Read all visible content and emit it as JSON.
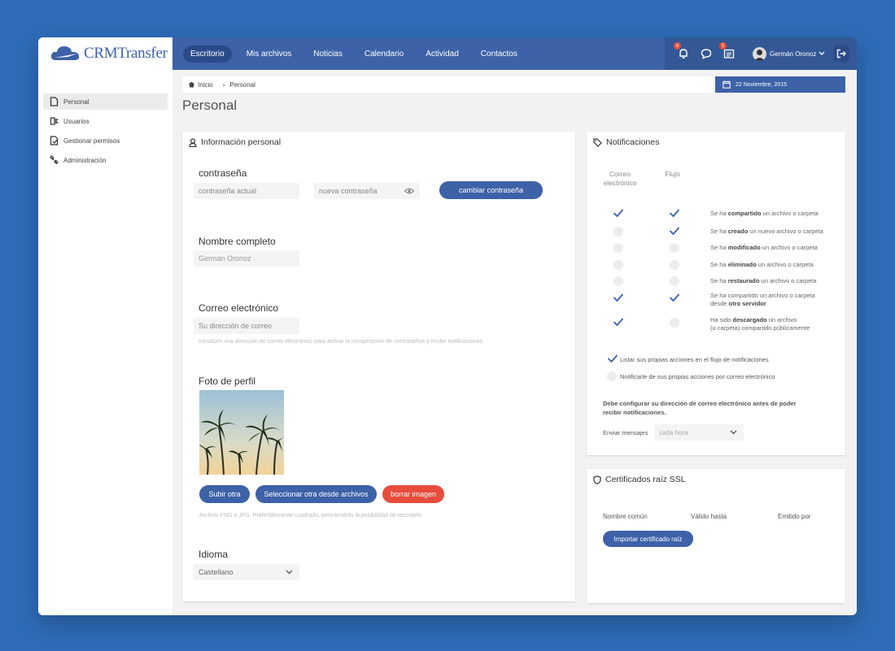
{
  "app": {
    "name": "CRMTransfer"
  },
  "nav": {
    "items": [
      "Escritorio",
      "Mis archivos",
      "Noticias",
      "Calendario",
      "Actividad",
      "Contactos"
    ]
  },
  "topbar": {
    "notifications_count": "6",
    "messages_count": "5",
    "user_name": "Germán Oronoz"
  },
  "sidebar": {
    "items": [
      "Personal",
      "Usuarios",
      "Gestionar permisos",
      "Administración"
    ]
  },
  "breadcrumb": {
    "home": "Inicio",
    "current": "Personal"
  },
  "date": "22 Noviembre, 2015",
  "page_title": "Personal",
  "personal": {
    "title": "Información personal",
    "password": {
      "heading": "contraseña",
      "current_placeholder": "contraseña actual",
      "new_placeholder": "nueva contraseña",
      "button": "cambiar contraseña"
    },
    "fullname": {
      "heading": "Nombre completo",
      "value": "German Oronoz"
    },
    "email": {
      "heading": "Correo electrónico",
      "placeholder": "Su dirección de correo",
      "hint": "Introducir una dirección de correo electrónico para activar la recuperación de contraseñas y recibir notificaciones"
    },
    "photo": {
      "heading": "Foto de perfil",
      "upload": "Subir otra",
      "select": "Seleccionar otra desde archivos",
      "delete": "borrar imagen",
      "hint": "Archivo PNG o JPG. Preferiblemente cuadrado, pero tendrás la posibilidad de recortarlo."
    },
    "language": {
      "heading": "Idioma",
      "value": "Castellano"
    }
  },
  "notifications": {
    "title": "Notificaciones",
    "col_email_1": "Correo",
    "col_email_2": "electrónico",
    "col_stream": "Flujo",
    "rows": [
      {
        "pre": "Se ha ",
        "bold": "compartido",
        "post": " un archivo o carpeta",
        "line2_pre": "",
        "line2_bold": "",
        "email": true,
        "stream": true
      },
      {
        "pre": "Se ha ",
        "bold": "creado",
        "post": " un nuevo archivo o carpeta",
        "line2_pre": "",
        "line2_bold": "",
        "email": false,
        "stream": true
      },
      {
        "pre": "Se ha ",
        "bold": "modificado",
        "post": " un archivo o carpeta",
        "line2_pre": "",
        "line2_bold": "",
        "email": false,
        "stream": false
      },
      {
        "pre": "Se ha ",
        "bold": "eliminado",
        "post": " un archivo o carpeta",
        "line2_pre": "",
        "line2_bold": "",
        "email": false,
        "stream": false
      },
      {
        "pre": "Se ha ",
        "bold": "restaurado",
        "post": " un archivo o carpeta",
        "line2_pre": "",
        "line2_bold": "",
        "email": false,
        "stream": false
      },
      {
        "pre": "Se ha compartido un archivo o carpeta",
        "bold": "",
        "post": "",
        "line2_pre": "desde ",
        "line2_bold": "otro servidor",
        "email": true,
        "stream": true
      },
      {
        "pre": "Ha sido ",
        "bold": "descargado",
        "post": " un archivo",
        "line2_pre": "(o carpeta) compartido públicamente",
        "line2_bold": "",
        "email": true,
        "stream": false
      }
    ],
    "option_own_actions": "Listar sus propias acciones en el flujo de notificaciones",
    "option_notify_email": "Notificarle de sus propias acciones por correo electrónico",
    "warning": "Debe configurar su dirección de correo electrónico antes de poder recibir notificaciones.",
    "send_label": "Enviar mensajes",
    "send_value": "cada hora"
  },
  "ssl": {
    "title": "Certificados raíz SSL",
    "col_name": "Nombre común",
    "col_valid": "Válido hasta",
    "col_issuer": "Emitido por",
    "button": "Importar certificado raíz"
  }
}
